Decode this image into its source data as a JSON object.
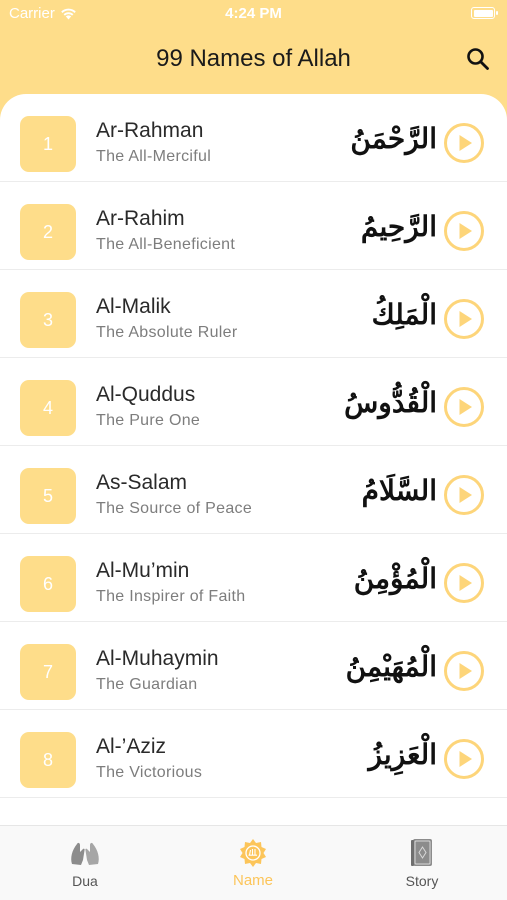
{
  "status_bar": {
    "carrier": "Carrier",
    "time": "4:24 PM"
  },
  "nav": {
    "title": "99 Names of Allah",
    "search_icon": "search-icon"
  },
  "names": [
    {
      "number": "1",
      "name": "Ar-Rahman",
      "meaning": "The All-Merciful",
      "arabic": "الرَّحْمَنُ"
    },
    {
      "number": "2",
      "name": "Ar-Rahim",
      "meaning": "The All-Beneficient",
      "arabic": "الرَّحِيمُ"
    },
    {
      "number": "3",
      "name": "Al-Malik",
      "meaning": "The Absolute Ruler",
      "arabic": "الْمَلِكُ"
    },
    {
      "number": "4",
      "name": "Al-Quddus",
      "meaning": "The Pure One",
      "arabic": "الْقُدُّوسُ"
    },
    {
      "number": "5",
      "name": "As-Salam",
      "meaning": "The Source of Peace",
      "arabic": "السَّلَامُ"
    },
    {
      "number": "6",
      "name": "Al-Mu’min",
      "meaning": "The Inspirer of Faith",
      "arabic": "الْمُؤْمِنُ"
    },
    {
      "number": "7",
      "name": "Al-Muhaymin",
      "meaning": "The Guardian",
      "arabic": "الْمُهَيْمِنُ"
    },
    {
      "number": "8",
      "name": "Al-’Aziz",
      "meaning": "The Victorious",
      "arabic": "الْعَزِيزُ"
    }
  ],
  "tabs": [
    {
      "label": "Dua",
      "icon": "praying-hands-icon",
      "active": false
    },
    {
      "label": "Name",
      "icon": "allah-emblem-icon",
      "active": true
    },
    {
      "label": "Story",
      "icon": "quran-book-icon",
      "active": false
    }
  ],
  "colors": {
    "accent": "#fedd8a",
    "active_tab": "#fcc55a",
    "play": "#fdd57a"
  }
}
